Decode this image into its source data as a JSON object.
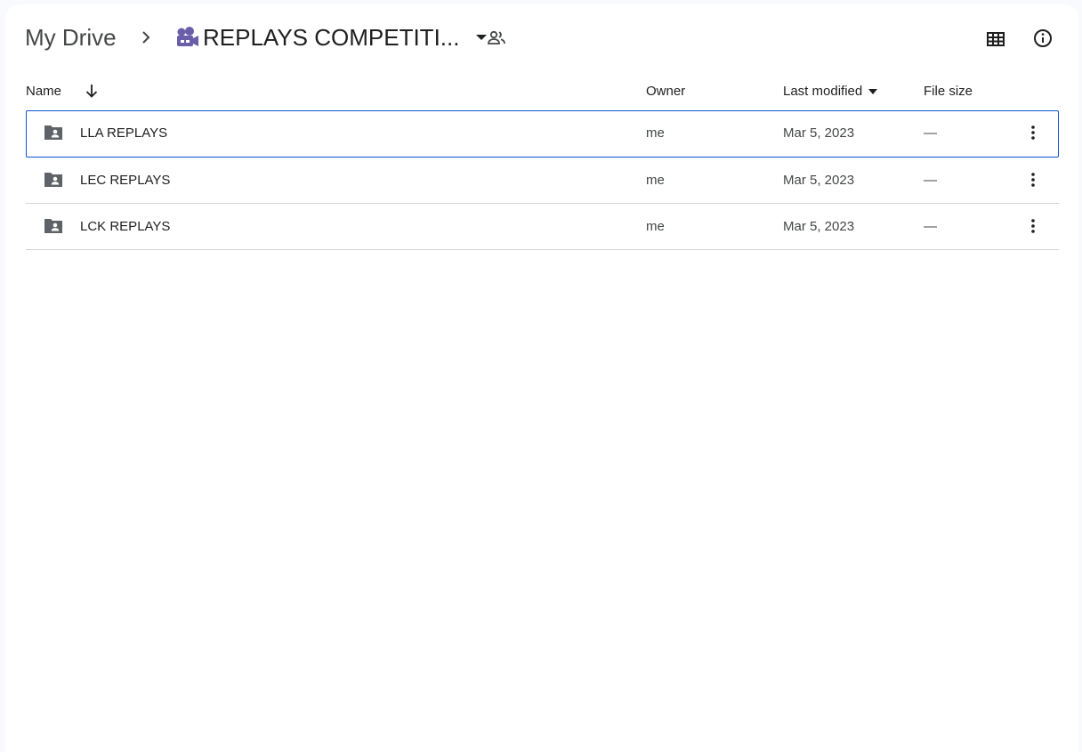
{
  "breadcrumb": {
    "root": "My Drive",
    "current": "REPLAYS COMPETITI..."
  },
  "icons": {
    "separator": "chevron-right-icon",
    "folder_type": "video-camera-icon",
    "caret": "caret-down-icon",
    "share": "people-icon",
    "view": "grid-view-icon",
    "details": "info-icon",
    "row": "shared-folder-icon",
    "row_menu": "more-vert-icon"
  },
  "colors": {
    "accent": "#0b57d0",
    "camera": "#6b5ea8",
    "icon": "#444746"
  },
  "table": {
    "headers": {
      "name": "Name",
      "owner": "Owner",
      "modified": "Last modified",
      "size": "File size"
    },
    "rows": [
      {
        "name": "LLA REPLAYS",
        "owner": "me",
        "modified": "Mar 5, 2023",
        "size": "—",
        "selected": true
      },
      {
        "name": "LEC REPLAYS",
        "owner": "me",
        "modified": "Mar 5, 2023",
        "size": "—",
        "selected": false
      },
      {
        "name": "LCK REPLAYS",
        "owner": "me",
        "modified": "Mar 5, 2023",
        "size": "—",
        "selected": false
      }
    ]
  }
}
